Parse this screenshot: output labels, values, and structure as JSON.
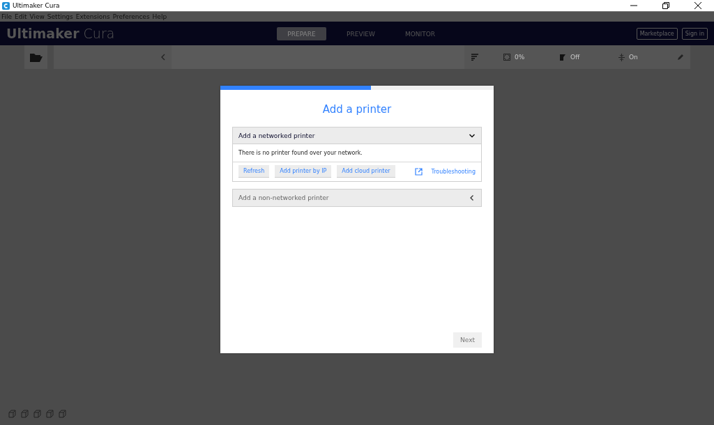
{
  "window": {
    "title": "Ultimaker Cura"
  },
  "menu": [
    {
      "label": "File"
    },
    {
      "label": "Edit"
    },
    {
      "label": "View"
    },
    {
      "label": "Settings"
    },
    {
      "label": "Extensions"
    },
    {
      "label": "Preferences"
    },
    {
      "label": "Help"
    }
  ],
  "header": {
    "logo_bold": "Ultimaker",
    "logo_light": "Cura",
    "tabs": [
      {
        "label": "PREPARE",
        "selected": true
      },
      {
        "label": "PREVIEW",
        "selected": false
      },
      {
        "label": "MONITOR",
        "selected": false
      }
    ],
    "buttons": [
      "Marketplace",
      "Sign in"
    ]
  },
  "print_settings": {
    "infill": "0%",
    "support": "Off",
    "adhesion": "On"
  },
  "dialog": {
    "progress": {
      "level": 0.55
    },
    "title": "Add a printer",
    "sections": [
      {
        "title": "Add a networked printer",
        "expanded": true,
        "message": "There is no printer found over your network.",
        "buttons": [
          "Refresh",
          "Add printer by IP",
          "Add cloud printer"
        ],
        "link": "Troubleshooting"
      },
      {
        "title": "Add a non-networked printer",
        "expanded": false
      }
    ],
    "next": {
      "label": "Next",
      "disabled": true
    }
  }
}
